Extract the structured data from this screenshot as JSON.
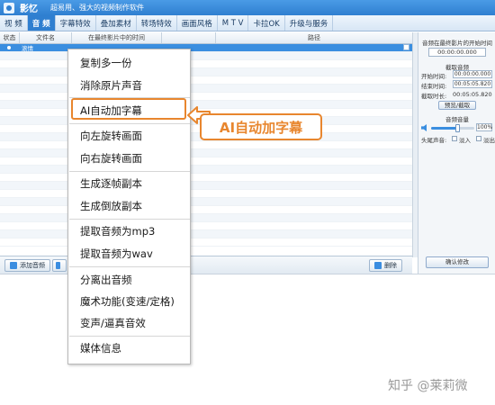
{
  "app": {
    "name": "影忆",
    "tagline": "超易用、强大的视频制作软件"
  },
  "menu": [
    "视 频",
    "音 频",
    "字幕特效",
    "叠加素材",
    "转场特效",
    "画面风格",
    "M T V",
    "卡拉OK",
    "升级与服务"
  ],
  "table": {
    "headers": [
      "状态",
      "文件名",
      "在最终影片中的时间",
      "",
      "路径"
    ],
    "selected_row": {
      "status": "",
      "filename": "滚情"
    }
  },
  "bottom_bar": {
    "add_audio": "添加音频",
    "delete": "删除"
  },
  "right_panel": {
    "start_time_title": "音频在最终影片的开始时间",
    "start_time": "00:00:00.000",
    "trim_title": "截取音频",
    "start_label": "开始时间:",
    "start_value": "00:00:00.000",
    "end_label": "结束时间:",
    "end_value": "00:05:05.820",
    "duration_label": "截取时长:",
    "duration_value": "00:05:05.820",
    "preview_button": "预览/截取",
    "volume_title": "音频音量",
    "volume_percent": "100%",
    "volume_level": 0.6,
    "fade_label": "头尾声音:",
    "fade_in": "淡入",
    "fade_out": "淡出",
    "confirm_button": "确认修改"
  },
  "context_menu": {
    "items": [
      "复制多一份",
      "消除原片声音",
      "AI自动加字幕",
      "向左旋转画面",
      "向右旋转画面",
      "生成逐帧副本",
      "生成倒放副本",
      "提取音频为mp3",
      "提取音频为wav",
      "分离出音频",
      "魔术功能(变速/定格)",
      "变声/逼真音效",
      "媒体信息"
    ],
    "highlighted_index": 2
  },
  "callout": {
    "text": "AI自动加字幕"
  },
  "watermark": "知乎 @莱莉微",
  "colors": {
    "accent": "#e8862e",
    "brand_blue": "#2f7fd0"
  }
}
